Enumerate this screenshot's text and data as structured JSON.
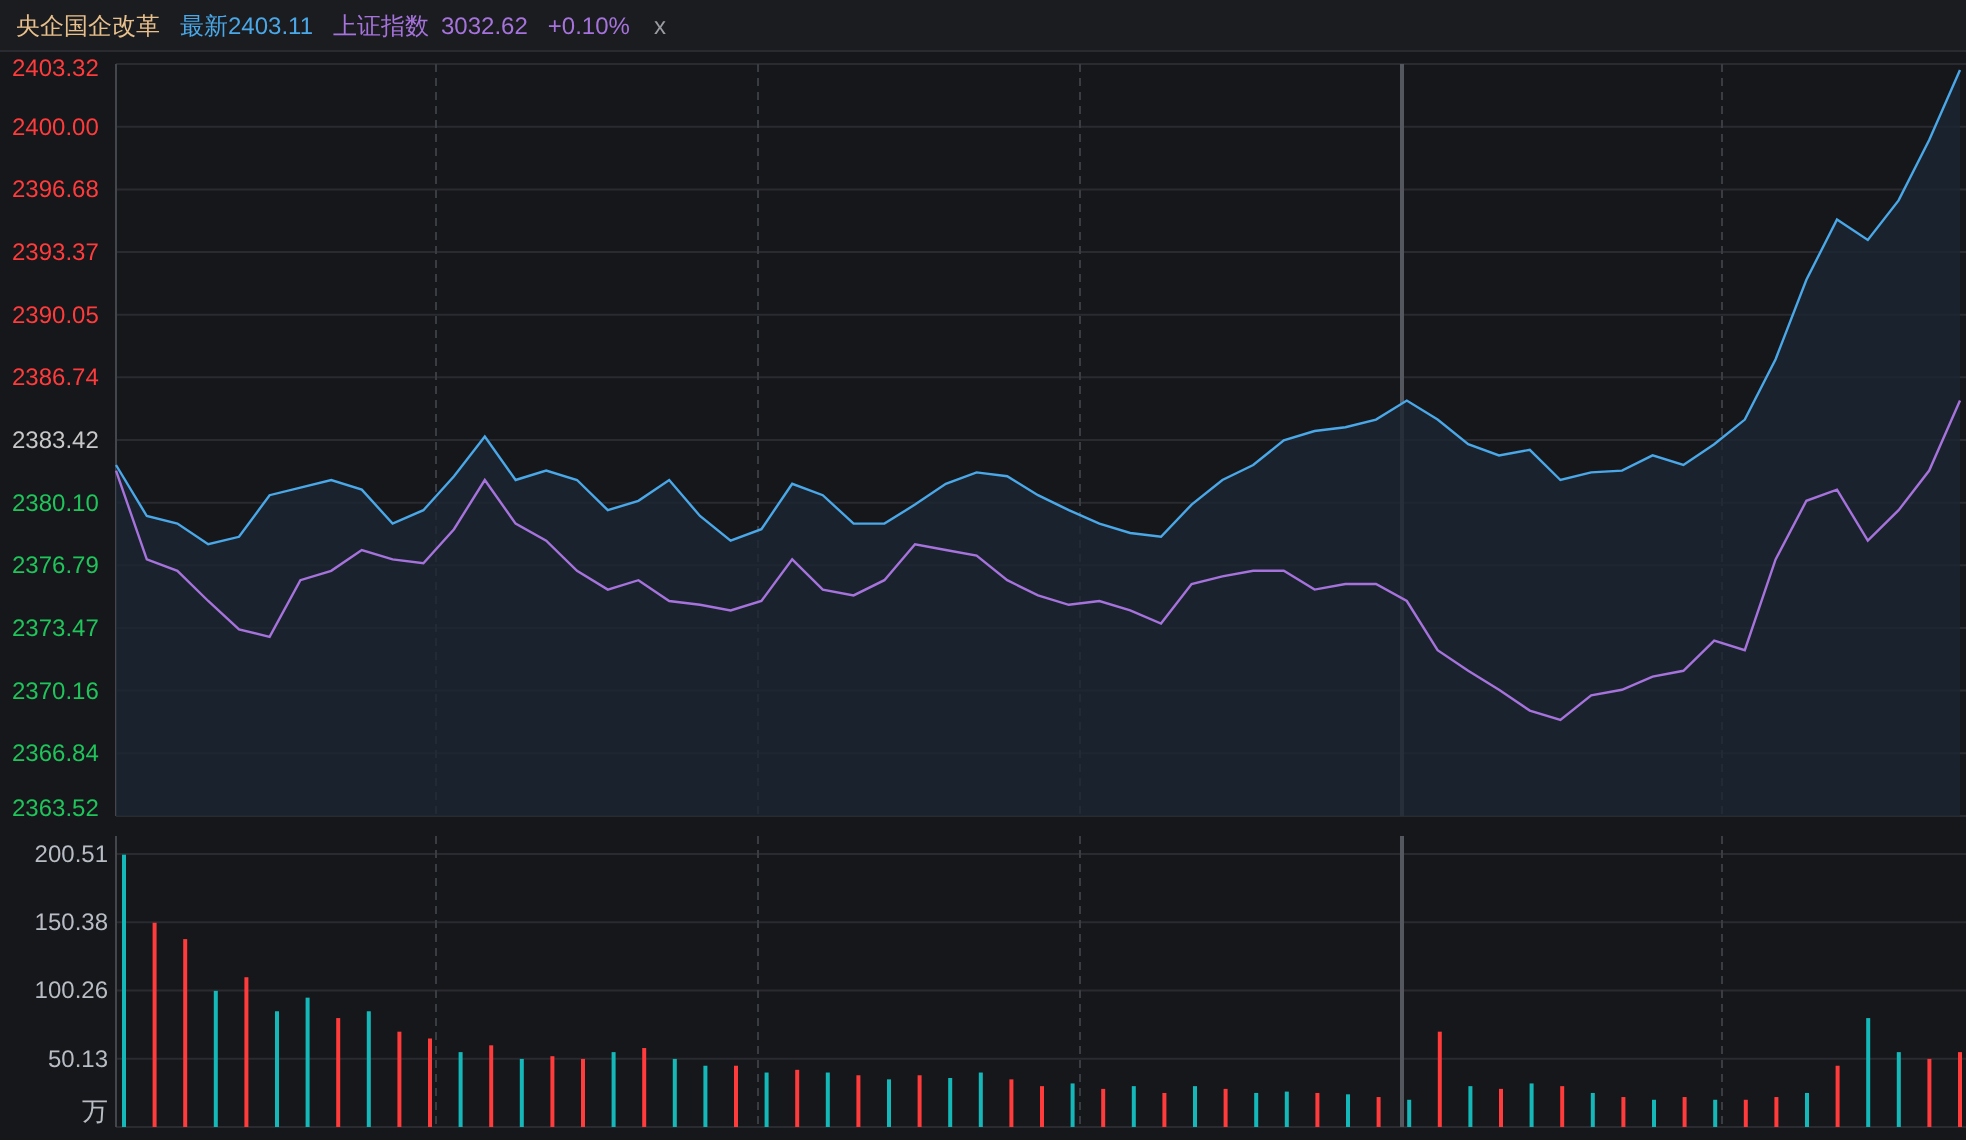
{
  "header": {
    "title": "央企国企改革",
    "latest": "最新2403.11",
    "index_name": "上证指数",
    "index_value": "3032.62",
    "index_change": "+0.10%",
    "close": "x"
  },
  "price_chart": {
    "chart_data": {
      "type": "line",
      "grid": true,
      "ylim": [
        2363.52,
        2403.32
      ],
      "yticks": [
        2363.52,
        2366.84,
        2370.16,
        2373.47,
        2376.79,
        {
          "value": 2380.1,
          "label": "2380.10"
        },
        2383.42,
        2386.74,
        2390.05,
        2393.37,
        2396.68,
        {
          "value": 2400,
          "label": "2400.00"
        },
        2403.32
      ],
      "series": [
        {
          "type": "area",
          "color": "#4aa8e8",
          "values": [
            2382.1,
            2379.4,
            2379.0,
            2377.9,
            2378.3,
            2380.5,
            2380.9,
            2381.3,
            2380.8,
            2379.0,
            2379.7,
            2381.5,
            2383.6,
            2381.3,
            2381.8,
            2381.3,
            2379.7,
            2380.2,
            2381.3,
            2379.4,
            2378.1,
            2378.7,
            2381.1,
            2380.5,
            2379.0,
            2379.0,
            2380.0,
            2381.1,
            2381.7,
            2381.5,
            2380.5,
            2379.7,
            2379.0,
            2378.5,
            2378.3,
            2380.0,
            2381.3,
            2382.1,
            2383.4,
            2383.9,
            2384.1,
            2384.5,
            2385.5,
            2384.5,
            2383.2,
            2382.6,
            2382.9,
            2381.3,
            2381.7,
            2381.8,
            2382.6,
            2382.1,
            2383.2,
            2384.5,
            2387.7,
            2391.9,
            2395.1,
            2394.0,
            2396.1,
            2399.3,
            2403.0
          ]
        },
        {
          "type": "line",
          "color": "#a673dc",
          "values": [
            2381.8,
            2377.1,
            2376.5,
            2374.9,
            2373.4,
            2373.0,
            2376.0,
            2376.5,
            2377.6,
            2377.1,
            2376.9,
            2378.7,
            2381.3,
            2379.0,
            2378.1,
            2376.5,
            2375.5,
            2376.0,
            2374.9,
            2374.7,
            2374.4,
            2374.9,
            2377.1,
            2375.5,
            2375.2,
            2376.0,
            2377.9,
            2377.6,
            2377.3,
            2376.0,
            2375.2,
            2374.7,
            2374.9,
            2374.4,
            2373.7,
            2375.8,
            2376.2,
            2376.5,
            2376.5,
            2375.5,
            2375.8,
            2375.8,
            2374.9,
            2372.3,
            2371.2,
            2370.2,
            2369.1,
            2368.6,
            2369.9,
            2370.2,
            2370.9,
            2371.2,
            2372.8,
            2372.3,
            2377.1,
            2380.2,
            2380.8,
            2378.1,
            2379.7,
            2381.8,
            2385.5
          ]
        }
      ]
    }
  },
  "volume_chart": {
    "chart_data": {
      "type": "bar",
      "stacked": true,
      "grid": true,
      "ylabel": "万",
      "ylim": [
        0,
        200.51
      ],
      "yticks": [
        50.13,
        100.26,
        150.38,
        200.51
      ],
      "series": [
        {
          "color": "#ff3b3b",
          "values": [
            null,
            150,
            138,
            null,
            110,
            null,
            null,
            80,
            null,
            70,
            65,
            null,
            60,
            null,
            52,
            50,
            null,
            58,
            null,
            null,
            45,
            null,
            42,
            null,
            38,
            null,
            38,
            null,
            null,
            35,
            30,
            null,
            28,
            null,
            25,
            null,
            28,
            null,
            null,
            25,
            null,
            22,
            null,
            70,
            null,
            28,
            null,
            30,
            null,
            22,
            null,
            22,
            null,
            20,
            22,
            null,
            45,
            null,
            null,
            50,
            55
          ]
        },
        {
          "color": "#14b8b8",
          "values": [
            200,
            null,
            null,
            100,
            null,
            85,
            95,
            null,
            85,
            null,
            null,
            55,
            null,
            50,
            null,
            null,
            55,
            null,
            50,
            45,
            null,
            40,
            null,
            40,
            null,
            35,
            null,
            36,
            40,
            null,
            null,
            32,
            null,
            30,
            null,
            30,
            null,
            25,
            26,
            null,
            24,
            null,
            20,
            null,
            30,
            null,
            32,
            null,
            25,
            null,
            20,
            null,
            20,
            null,
            null,
            25,
            null,
            80,
            55,
            null,
            null
          ]
        }
      ]
    }
  }
}
